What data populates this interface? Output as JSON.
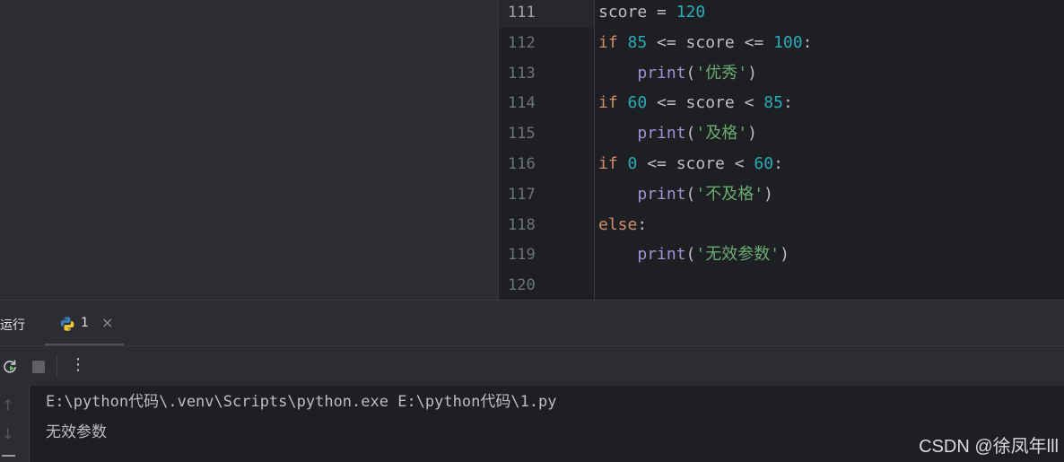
{
  "editor": {
    "line_numbers": [
      "111",
      "112",
      "113",
      "114",
      "115",
      "116",
      "117",
      "118",
      "119",
      "120"
    ],
    "lines": [
      [
        {
          "t": "score = ",
          "c": ""
        },
        {
          "t": "120",
          "c": "num"
        }
      ],
      [
        {
          "t": "if ",
          "c": "kw"
        },
        {
          "t": "85",
          "c": "num"
        },
        {
          "t": " <= score <= ",
          "c": ""
        },
        {
          "t": "100",
          "c": "num"
        },
        {
          "t": ":",
          "c": ""
        }
      ],
      [
        {
          "t": "    ",
          "c": ""
        },
        {
          "t": "print",
          "c": "fn"
        },
        {
          "t": "(",
          "c": ""
        },
        {
          "t": "'优秀'",
          "c": "str"
        },
        {
          "t": ")",
          "c": ""
        }
      ],
      [
        {
          "t": "if ",
          "c": "kw"
        },
        {
          "t": "60",
          "c": "num"
        },
        {
          "t": " <= score < ",
          "c": ""
        },
        {
          "t": "85",
          "c": "num"
        },
        {
          "t": ":",
          "c": ""
        }
      ],
      [
        {
          "t": "    ",
          "c": ""
        },
        {
          "t": "print",
          "c": "fn"
        },
        {
          "t": "(",
          "c": ""
        },
        {
          "t": "'及格'",
          "c": "str"
        },
        {
          "t": ")",
          "c": ""
        }
      ],
      [
        {
          "t": "if ",
          "c": "kw"
        },
        {
          "t": "0",
          "c": "num"
        },
        {
          "t": " <= score < ",
          "c": ""
        },
        {
          "t": "60",
          "c": "num"
        },
        {
          "t": ":",
          "c": ""
        }
      ],
      [
        {
          "t": "    ",
          "c": ""
        },
        {
          "t": "print",
          "c": "fn"
        },
        {
          "t": "(",
          "c": ""
        },
        {
          "t": "'不及格'",
          "c": "str"
        },
        {
          "t": ")",
          "c": ""
        }
      ],
      [
        {
          "t": "else",
          "c": "kw"
        },
        {
          "t": ":",
          "c": ""
        }
      ],
      [
        {
          "t": "    ",
          "c": ""
        },
        {
          "t": "print",
          "c": "fn"
        },
        {
          "t": "(",
          "c": ""
        },
        {
          "t": "'无效参数'",
          "c": "str"
        },
        {
          "t": ")",
          "c": ""
        }
      ],
      []
    ]
  },
  "run_panel": {
    "title": "运行",
    "tab_label": "1",
    "tab_close": "×",
    "icons": {
      "tab": "python-icon",
      "rerun": "rerun-icon",
      "stop": "stop-icon",
      "more": "more-icon",
      "up": "arrow-up-icon",
      "down": "arrow-down-icon",
      "wrap": "soft-wrap-icon"
    },
    "more_glyph": "⋮",
    "up_glyph": "↑",
    "down_glyph": "↓"
  },
  "console": {
    "lines": [
      "E:\\python代码\\.venv\\Scripts\\python.exe E:\\python代码\\1.py",
      "无效参数"
    ]
  },
  "watermark": "CSDN @徐凤年lll",
  "colors": {
    "background": "#1e1f22",
    "panel": "#2b2d30",
    "keyword": "#cf8e6d",
    "number": "#2aacb8",
    "function": "#9e94d5",
    "string": "#6aab73",
    "text": "#bcbec4"
  }
}
